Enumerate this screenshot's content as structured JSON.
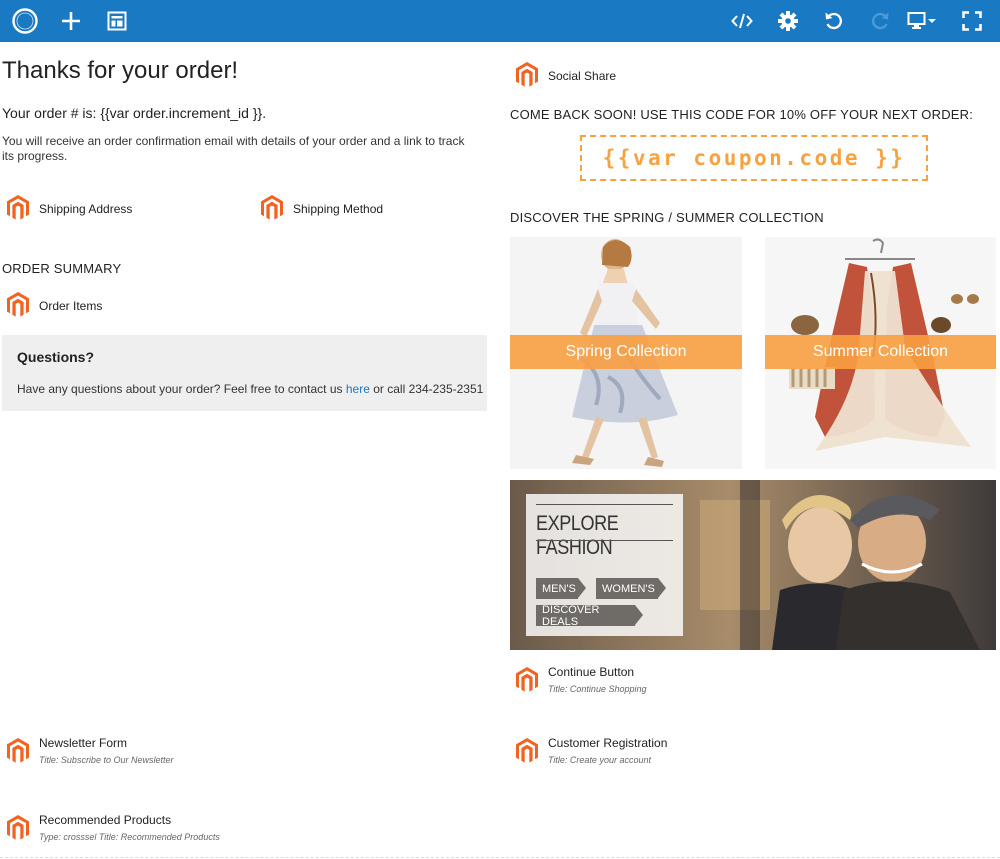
{
  "toolbar": {
    "left_icons": [
      "logo-ring-icon",
      "plus-icon",
      "template-icon"
    ],
    "right_icons": [
      "code-icon",
      "gear-icon",
      "undo-icon",
      "redo-icon",
      "desktop-icon",
      "fullscreen-icon"
    ],
    "color": "#1979c3"
  },
  "left": {
    "title": "Thanks for your order!",
    "order_number": "Your order # is: {{var order.increment_id }}.",
    "confirmation": "You will receive an order confirmation email with details of your order and a link to track its progress.",
    "shipping_address": "Shipping Address",
    "shipping_method": "Shipping Method",
    "order_summary": "ORDER SUMMARY",
    "order_items": "Order Items",
    "questions": {
      "title": "Questions?",
      "text_before": "Have any questions about your order? Feel free to contact us",
      "link": "here",
      "text_after": "or call 234-235-2351"
    },
    "newsletter": {
      "label": "Newsletter Form",
      "sub": "Title: Subscribe to Our Newsletter"
    },
    "recommended": {
      "label": "Recommended Products",
      "sub": "Type: crosssel Title: Recommended Products"
    }
  },
  "right": {
    "social_share": "Social Share",
    "come_back": "COME BACK SOON! USE THIS CODE FOR 10% OFF YOUR NEXT ORDER:",
    "coupon_code": "{{var coupon.code }}",
    "collection_heading": "DISCOVER THE SPRING / SUMMER COLLECTION",
    "spring": "Spring Collection",
    "summer": "Summer Collection",
    "banner": {
      "title": "EXPLORE FASHION",
      "mens": "MEN'S",
      "womens": "WOMEN'S",
      "deals": "DISCOVER DEALS"
    },
    "continue_button": {
      "label": "Continue Button",
      "sub": "Title: Continue Shopping"
    },
    "customer_registration": {
      "label": "Customer Registration",
      "sub": "Title: Create your account"
    }
  },
  "colors": {
    "accent_orange": "#f7a240",
    "magento_orange": "#f26322",
    "link_blue": "#1979c3"
  }
}
